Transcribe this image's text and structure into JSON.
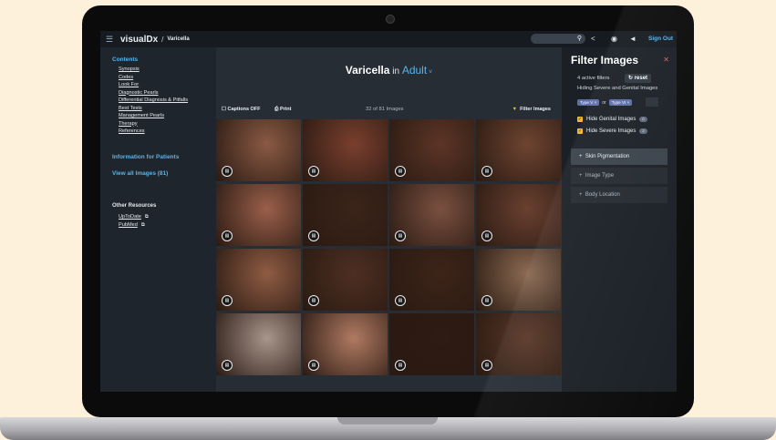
{
  "app": {
    "logo": "visualDx",
    "breadcrumb_sep": "/",
    "breadcrumb": "Varicella",
    "signout_label": "Sign Out"
  },
  "sidebar": {
    "contents_title": "Contents",
    "toc": [
      "Synopsis",
      "Codes",
      "Look For",
      "Diagnostic Pearls",
      "Differential Diagnosis & Pitfalls",
      "Best Tests",
      "Management Pearls",
      "Therapy",
      "References"
    ],
    "patients_link": "Information for Patients",
    "view_all": "View all Images (81)",
    "other_title": "Other Resources",
    "other_links": [
      "UpToDate",
      "PubMed"
    ]
  },
  "main": {
    "title_topic": "Varicella",
    "title_in": " in ",
    "title_population": "Adult",
    "captions_label": "Captions OFF",
    "print_label": "Print",
    "image_count": "32 of 81 Images",
    "filter_label": "Filter Images"
  },
  "filter_panel": {
    "title": "Filter Images",
    "active_filters": "4 active filters",
    "reset_label": "reset",
    "hiding_text": "Hiding Severe and Genital Images",
    "chip_1": "Type V",
    "chip_or": "or",
    "chip_2": "Type VI",
    "hide_genital": "Hide Genital Images",
    "hide_genital_count": "0",
    "hide_severe": "Hide Severe Images",
    "hide_severe_count": "2",
    "sections": [
      "Skin Pigmentation",
      "Image Type",
      "Body Location"
    ]
  },
  "tiles": [
    {
      "bg": "#8a5a44"
    },
    {
      "bg": "#7a3f2e"
    },
    {
      "bg": "#5c3526"
    },
    {
      "bg": "#6e4431"
    },
    {
      "bg": "#9a5f4a"
    },
    {
      "bg": "#3b241a"
    },
    {
      "bg": "#7a5040"
    },
    {
      "bg": "#6a4030"
    },
    {
      "bg": "#8f5c43"
    },
    {
      "bg": "#4e2f22"
    },
    {
      "bg": "#3d2419"
    },
    {
      "bg": "#8b6a52"
    },
    {
      "bg": "#a8958c"
    },
    {
      "bg": "#b07a62"
    },
    {
      "bg": "#2e1b13"
    },
    {
      "bg": "#5a3828"
    }
  ],
  "colors": {
    "accent": "#58b4e8",
    "filter_icon": "#f2b632"
  }
}
